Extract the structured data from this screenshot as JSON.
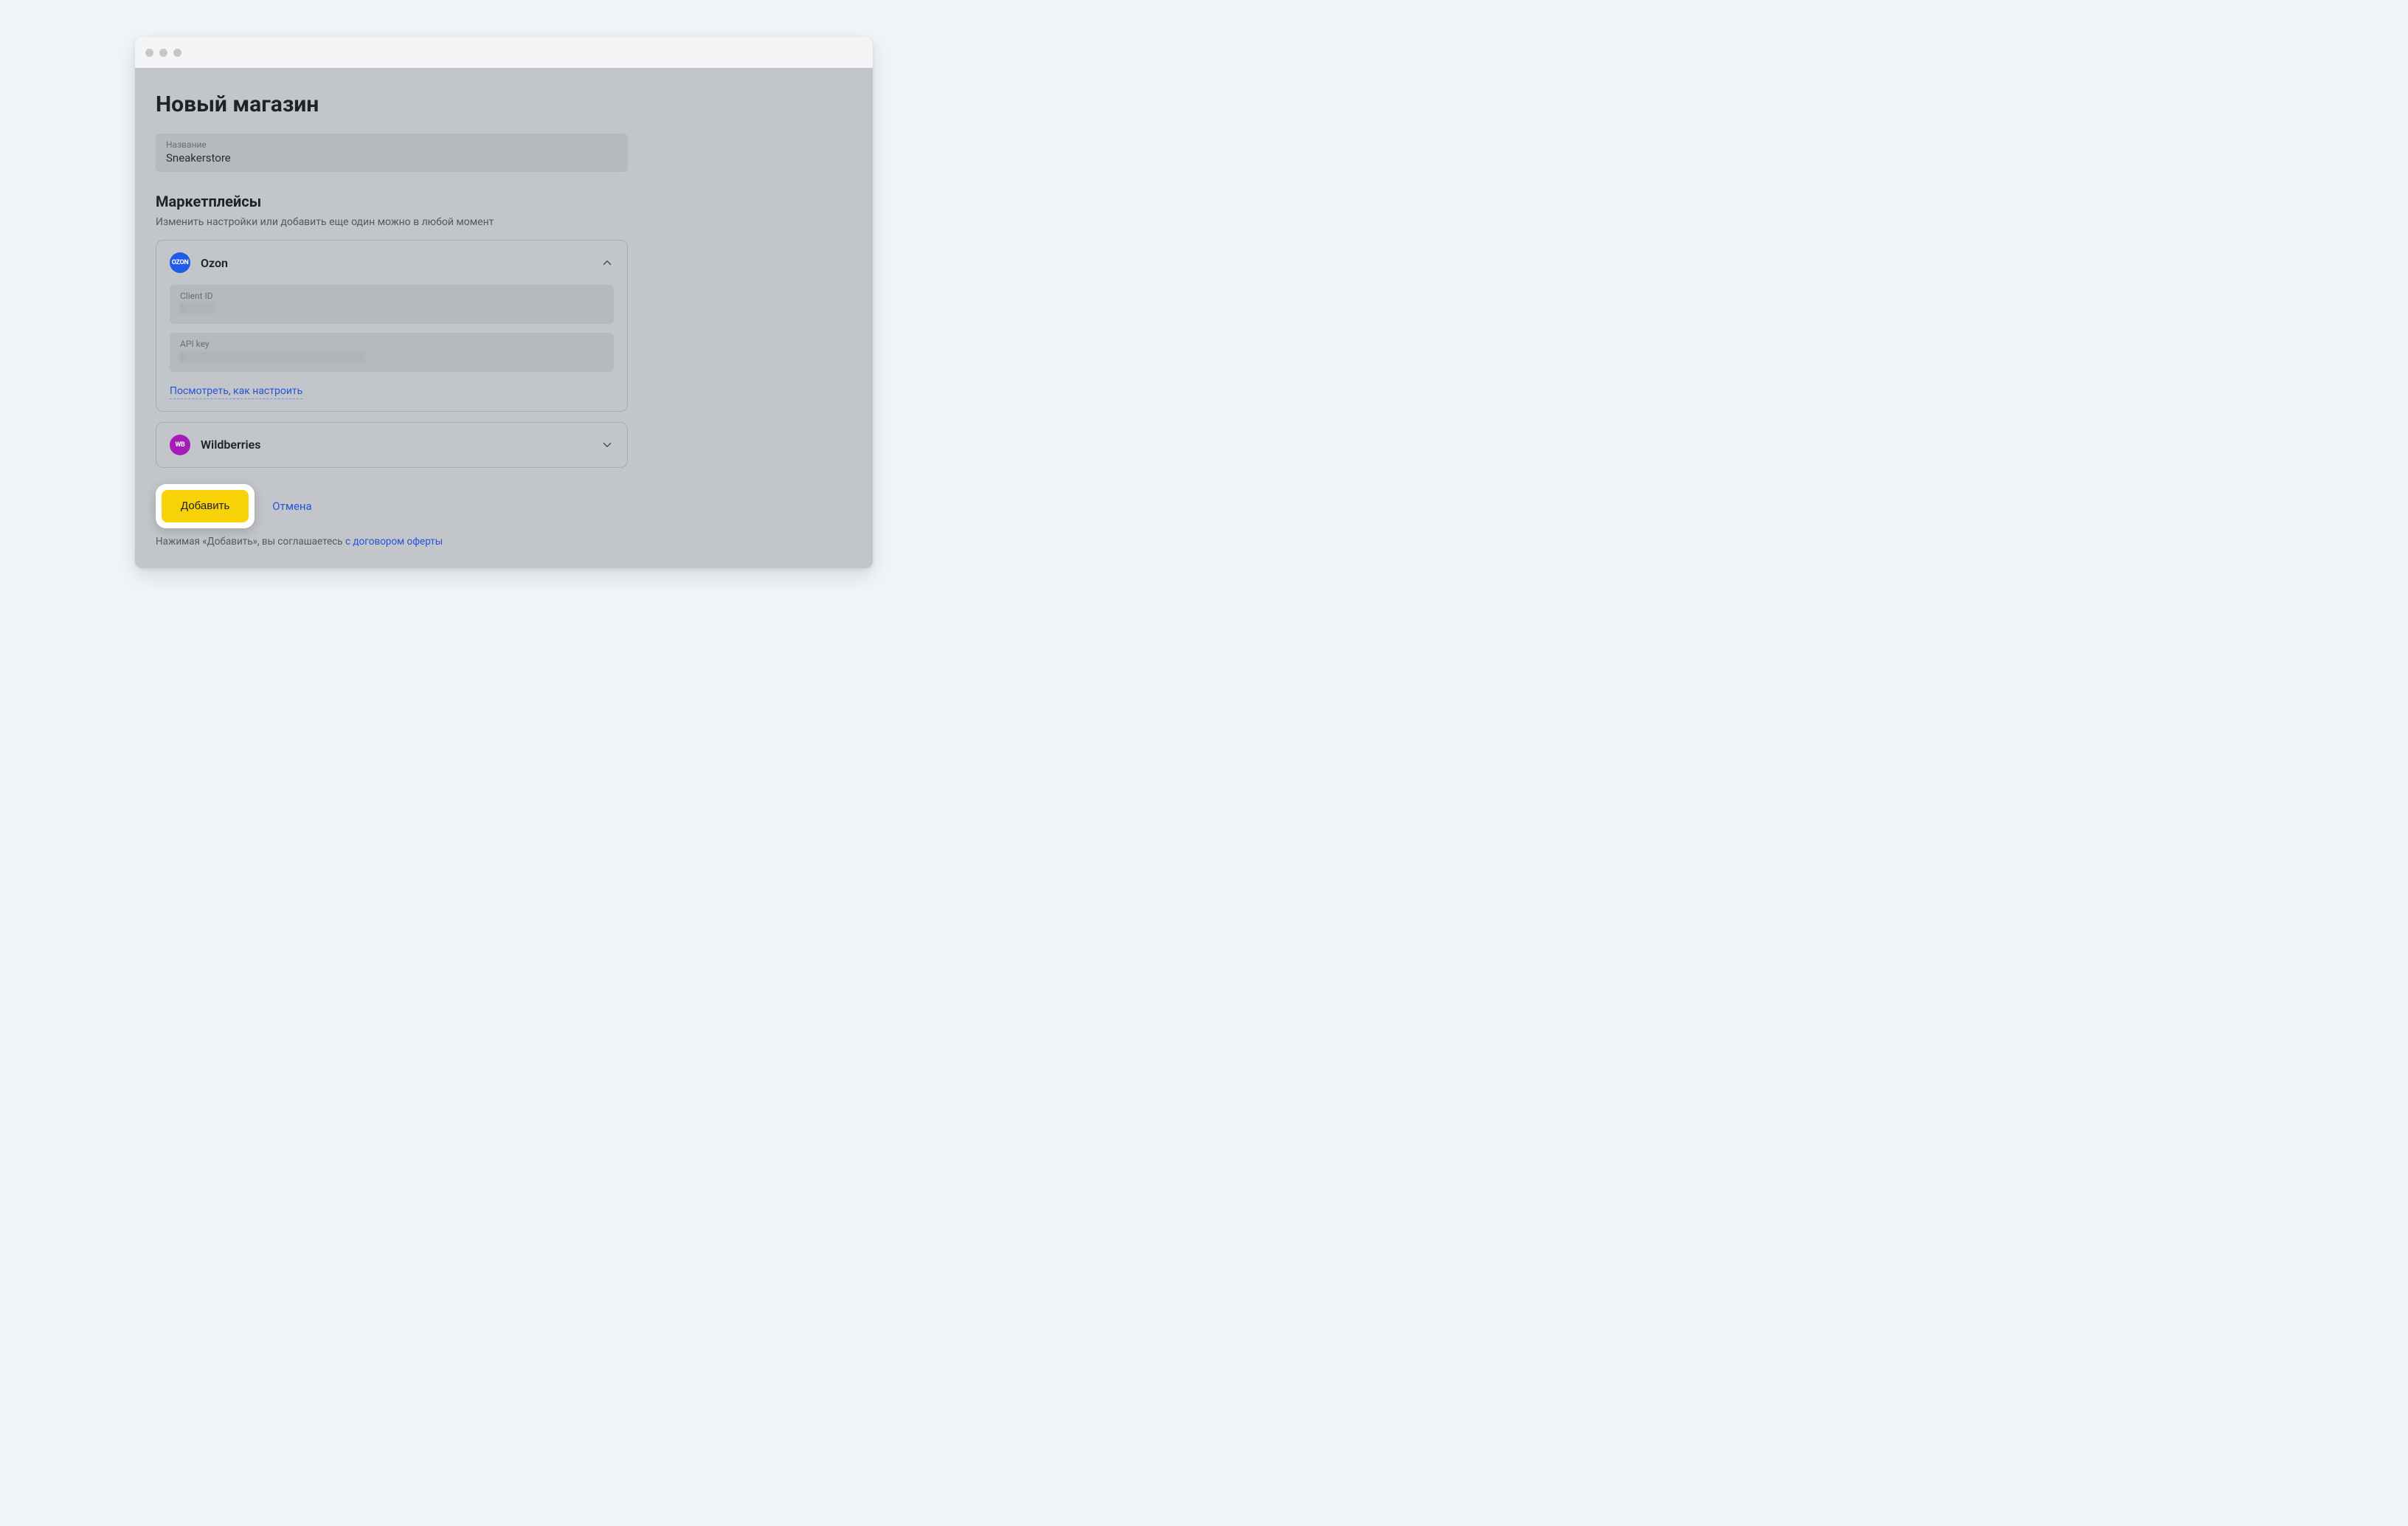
{
  "page": {
    "title": "Новый магазин"
  },
  "store_name": {
    "label": "Название",
    "value": "Sneakerstore"
  },
  "marketplaces": {
    "title": "Маркетплейсы",
    "hint": "Изменить настройки или добавить еще один можно в любой момент"
  },
  "ozon": {
    "name": "Ozon",
    "badge_text": "OZON",
    "client_id_label": "Client ID",
    "api_key_label": "API key",
    "setup_link": "Посмотреть, как настроить"
  },
  "wildberries": {
    "name": "Wildberries",
    "badge_text": "WB"
  },
  "actions": {
    "add": "Добавить",
    "cancel": "Отмена"
  },
  "terms": {
    "prefix": "Нажимая «Добавить», вы соглашаетесь ",
    "link": "с договором оферты"
  }
}
